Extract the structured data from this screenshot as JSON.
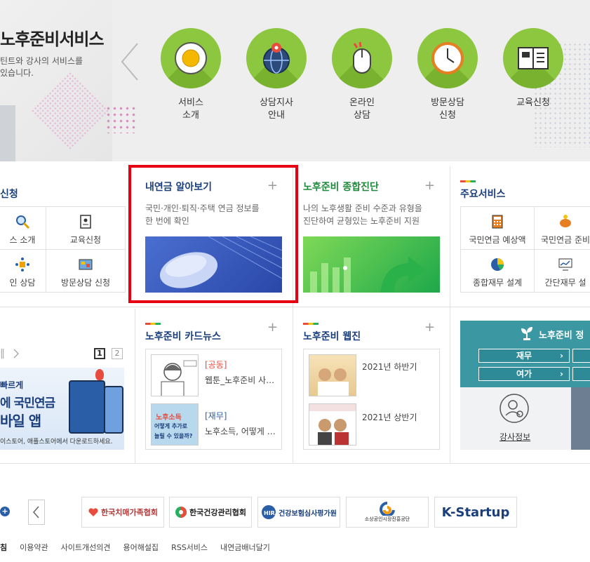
{
  "hero": {
    "title": "노후준비서비스",
    "desc_line1": "틴트와 강사의 서비스를",
    "desc_line2": "있습니다.",
    "services": [
      {
        "label1": "서비스",
        "label2": "소개",
        "icon": "egg-plate-icon"
      },
      {
        "label1": "상담지사",
        "label2": "안내",
        "icon": "globe-pin-icon"
      },
      {
        "label1": "온라인",
        "label2": "상담",
        "icon": "mouse-icon"
      },
      {
        "label1": "방문상담",
        "label2": "신청",
        "icon": "clock-icon"
      },
      {
        "label1": "교육신청",
        "label2": "",
        "icon": "book-icon"
      }
    ]
  },
  "left_panel": {
    "title": "신청",
    "items": [
      "스 소개",
      "교육신청",
      "인 상담",
      "방문상담 신청"
    ]
  },
  "pension_panel": {
    "title": "내연금 알아보기",
    "desc1": "국민·개인·퇴직·주택 연금 정보를",
    "desc2": "한 번에 확인",
    "plus": "+"
  },
  "diagnosis_panel": {
    "title": "노후준비 종합진단",
    "desc1": "나의 노후생활 준비 수준과 유형을",
    "desc2": "진단하여 균형있는 노후준비 지원",
    "plus": "+"
  },
  "main_services": {
    "title": "주요서비스",
    "items": [
      "국민연금 예상액",
      "국민연금 준비",
      "종합재무 설계",
      "간단재무 설"
    ]
  },
  "banner": {
    "page1": "1",
    "page2": "2",
    "line1": "빠르게",
    "line2": "에 국민연금",
    "line3": "바일 앱",
    "line4": "이스토어, 애플스토어에서 다운로드하세요."
  },
  "cardnews": {
    "title": "노후준비 카드뉴스",
    "plus": "+",
    "items": [
      {
        "tag": "[공동]",
        "text": "웹툰_노후준비 사…"
      },
      {
        "tag": "[재무]",
        "text": "노후소득, 어떻게 …",
        "thumb_text1": "노후소득",
        "thumb_text2": "어떻게 추가로",
        "thumb_text3": "늘릴 수 있을까?"
      }
    ]
  },
  "webzine": {
    "title": "노후준비 웹진",
    "plus": "+",
    "items": [
      {
        "text": "2021년 하반기"
      },
      {
        "text": "2021년 상반기"
      }
    ]
  },
  "right_box": {
    "title": "노후준비 정",
    "btn1": "재무",
    "btn2": "여가",
    "arrow": "›",
    "caption": "강사정보"
  },
  "partners": [
    "한국치매가족협회",
    "한국건강관리협회",
    "건강보험심사평가원",
    "소상공인시장진흥공단",
    "K-Startup"
  ],
  "footer": {
    "links": [
      "침",
      "이용약관",
      "사이트개선의견",
      "용어해설집",
      "RSS서비스",
      "내연금배너달기"
    ]
  }
}
